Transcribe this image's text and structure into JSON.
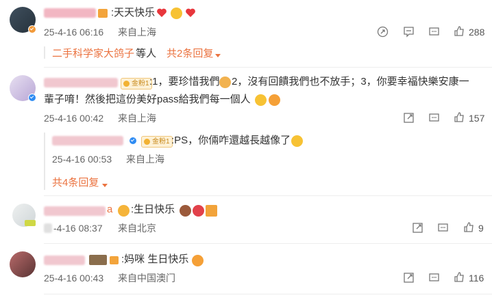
{
  "comments": [
    {
      "text": ":天天快乐",
      "date": "25-4-16 06:16",
      "location": "来自上海",
      "likes": "288",
      "replies_summary": {
        "name": "二手科学家大鸽子",
        "middle": " 等人 ",
        "link": "共2条回复"
      }
    },
    {
      "badge": "金粉1",
      "text_line1": ":1，要珍惜我們",
      "text_line1b": " 2，沒有回饋我們也不放手；3，你要幸福快樂安康一",
      "text_line2": "輩子唷！然後把這份美好pass給我們每一個人",
      "date": "25-4-16 00:42",
      "location": "来自上海",
      "likes": "157",
      "reply": {
        "badge": "金粉1",
        "text": ":PS，你倆咋還越長越像了",
        "date": "25-4-16 00:53",
        "location": "来自上海"
      },
      "more_replies": "共4条回复"
    },
    {
      "name_suffix": "a",
      "text": ":生日快乐",
      "date": "-4-16 08:37",
      "location": "来自北京",
      "likes": "9"
    },
    {
      "text": ":妈咪 生日快乐",
      "date": "25-4-16 00:43",
      "location": "来自中国澳门",
      "likes": "116"
    }
  ],
  "icons": [
    "share-icon",
    "comment-icon",
    "like-icon",
    "chevron-down-icon",
    "verified-icon"
  ],
  "colors": {
    "accent": "#eb7340",
    "meta": "#666666",
    "verified": "#2f8cf3",
    "heart": "#e8363c"
  }
}
